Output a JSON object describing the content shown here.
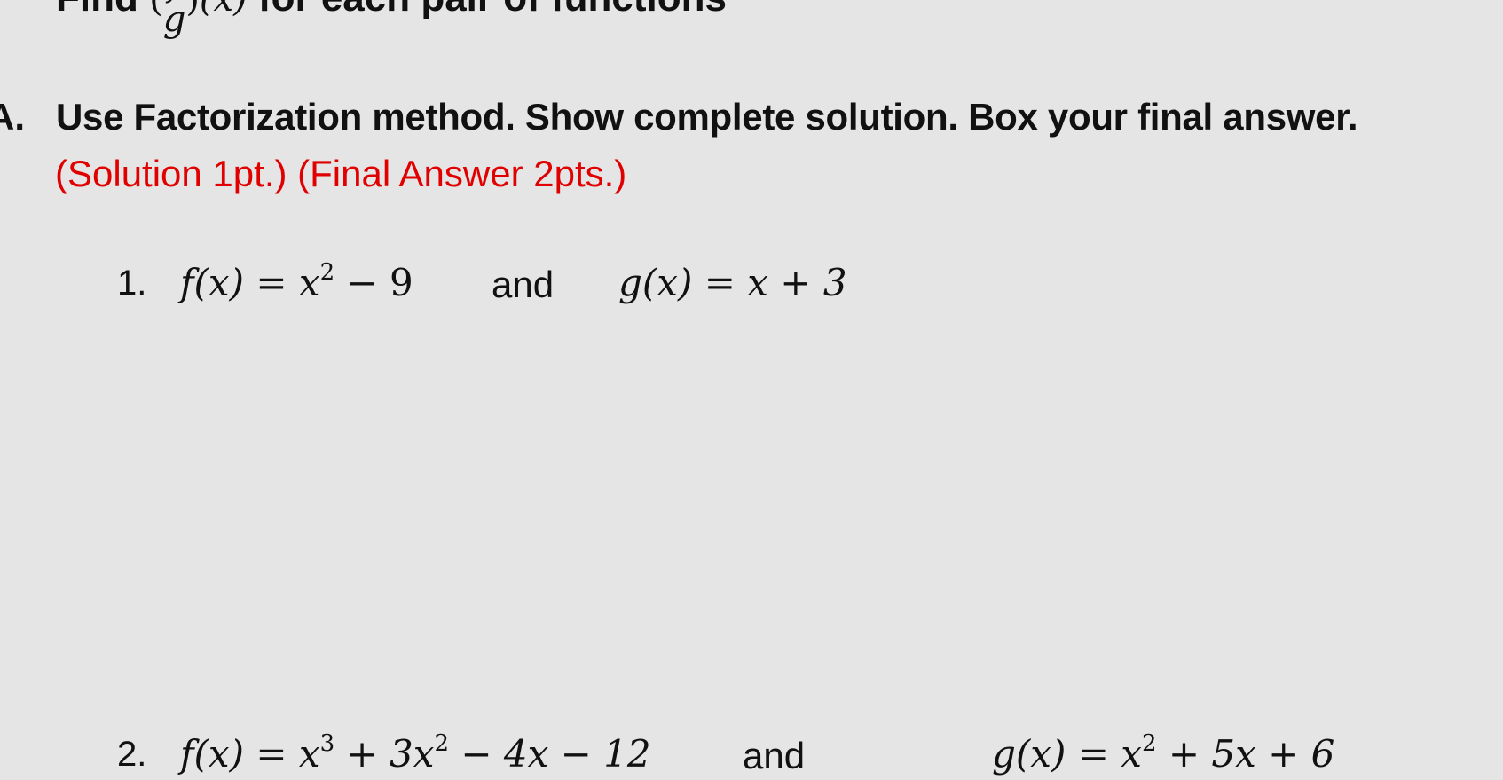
{
  "header": {
    "find": "Find",
    "frac_num": "f",
    "frac_den": "g",
    "arg": "(x)",
    "rest": "for each pair of functions"
  },
  "section": {
    "letter": "A.",
    "instruction": "Use Factorization method. Show complete solution. Box your final answer.",
    "points": "(Solution 1pt.) (Final Answer 2pts.)",
    "points_color": "#e00000"
  },
  "problems": [
    {
      "number": "1.",
      "f_lhs": "f(x) = x",
      "f_exp": "2",
      "f_rest": " − 9",
      "and": "and",
      "g_lhs": "g(x) = x + 3",
      "g_exp": "",
      "g_rest": ""
    },
    {
      "number": "2.",
      "f_lhs": "f(x) = x",
      "f_exp": "3",
      "f_rest": " + 3x",
      "f_exp2": "2",
      "f_rest2": " − 4x − 12",
      "and": "and",
      "g_lhs": "g(x) = x",
      "g_exp": "2",
      "g_rest": " + 5x + 6"
    }
  ]
}
